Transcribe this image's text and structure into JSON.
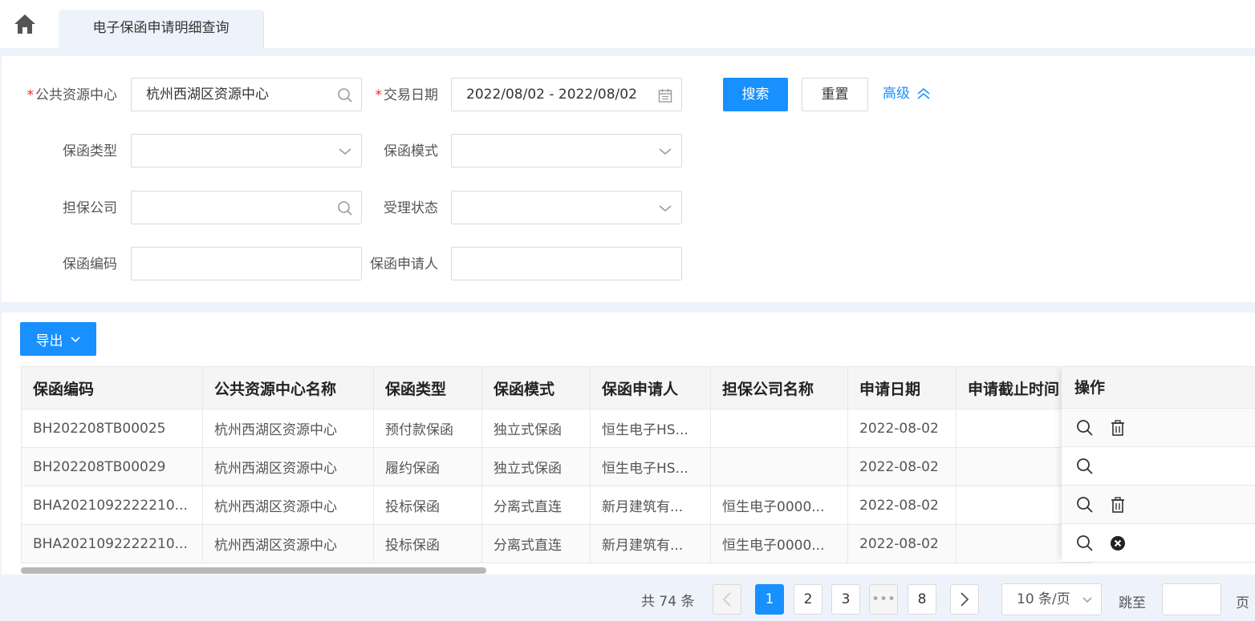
{
  "tab": {
    "title": "电子保函申请明细查询"
  },
  "filter": {
    "resource_center": {
      "label": "公共资源中心",
      "required_mark": "*",
      "value": "杭州西湖区资源中心"
    },
    "trade_date": {
      "label": "交易日期",
      "required_mark": "*",
      "value": "2022/08/02 - 2022/08/02"
    },
    "guarantee_type": {
      "label": "保函类型",
      "value": ""
    },
    "guarantee_mode": {
      "label": "保函模式",
      "value": ""
    },
    "guarantor_company": {
      "label": "担保公司",
      "value": ""
    },
    "accept_status": {
      "label": "受理状态",
      "value": ""
    },
    "guarantee_code": {
      "label": "保函编码",
      "value": ""
    },
    "applicant": {
      "label": "保函申请人",
      "value": ""
    },
    "search_label": "搜索",
    "reset_label": "重置",
    "advanced_label": "高级"
  },
  "toolbar": {
    "export_label": "导出"
  },
  "table": {
    "columns": [
      "保函编码",
      "公共资源中心名称",
      "保函类型",
      "保函模式",
      "保函申请人",
      "担保公司名称",
      "申请日期",
      "申请截止时间"
    ],
    "action_header": "操作",
    "rows": [
      {
        "cells": [
          "BH202208TB00025",
          "杭州西湖区资源中心",
          "预付款保函",
          "独立式保函",
          "恒生电子HS...",
          "",
          "2022-08-02",
          ""
        ],
        "actions": [
          "search",
          "delete"
        ]
      },
      {
        "cells": [
          "BH202208TB00029",
          "杭州西湖区资源中心",
          "履约保函",
          "独立式保函",
          "恒生电子HS...",
          "",
          "2022-08-02",
          ""
        ],
        "actions": [
          "search"
        ]
      },
      {
        "cells": [
          "BHA2021092222210...",
          "杭州西湖区资源中心",
          "投标保函",
          "分离式直连",
          "新月建筑有...",
          "恒生电子0000...",
          "2022-08-02",
          ""
        ],
        "actions": [
          "search",
          "delete"
        ]
      },
      {
        "cells": [
          "BHA2021092222210...",
          "杭州西湖区资源中心",
          "投标保函",
          "分离式直连",
          "新月建筑有...",
          "恒生电子0000...",
          "2022-08-02",
          ""
        ],
        "actions": [
          "search",
          "cancel"
        ]
      }
    ]
  },
  "pagination": {
    "total_text": "共 74 条",
    "pages": [
      "1",
      "2",
      "3",
      "•••",
      "8"
    ],
    "current": "1",
    "page_size": "10 条/页",
    "jump_label": "跳至",
    "page_unit": "页"
  }
}
